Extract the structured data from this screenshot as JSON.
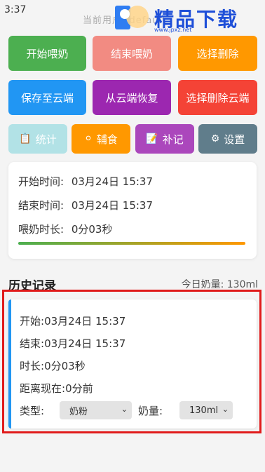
{
  "status": {
    "time": "3:37"
  },
  "header": {
    "user_fragment": "当前用户: default"
  },
  "watermark": {
    "brand": "精品下载",
    "url": "www.jpxz.net"
  },
  "actions": {
    "start": "开始喂奶",
    "end": "结束喂奶",
    "select_delete": "选择删除",
    "save_cloud": "保存至云端",
    "restore_cloud": "从云端恢复",
    "select_delete_cloud": "选择删除云端",
    "stats": "统计",
    "food": "辅食",
    "note": "补记",
    "settings": "设置"
  },
  "summary": {
    "start_label": "开始时间:",
    "start_value": "03月24日 15:37",
    "end_label": "结束时间:",
    "end_value": "03月24日 15:37",
    "duration_label": "喂奶时长:",
    "duration_value": "0分03秒"
  },
  "history": {
    "title": "历史记录",
    "today_label": "今日奶量:",
    "today_value": "130ml"
  },
  "record": {
    "start_label": "开始:",
    "start_value": "03月24日 15:37",
    "end_label": "结束:",
    "end_value": "03月24日 15:37",
    "duration_label": "时长:",
    "duration_value": "0分03秒",
    "ago_label": "距离现在:",
    "ago_value": "0分前",
    "type_label": "类型:",
    "type_value": "奶粉",
    "amount_label": "奶量:",
    "amount_value": "130ml"
  },
  "colors": {
    "green": "#4caf50",
    "pink": "#f28b82",
    "orange": "#ff9800",
    "blue": "#2196f3",
    "purple": "#9c27b0",
    "red": "#f44336",
    "highlight": "#e01b1b"
  }
}
